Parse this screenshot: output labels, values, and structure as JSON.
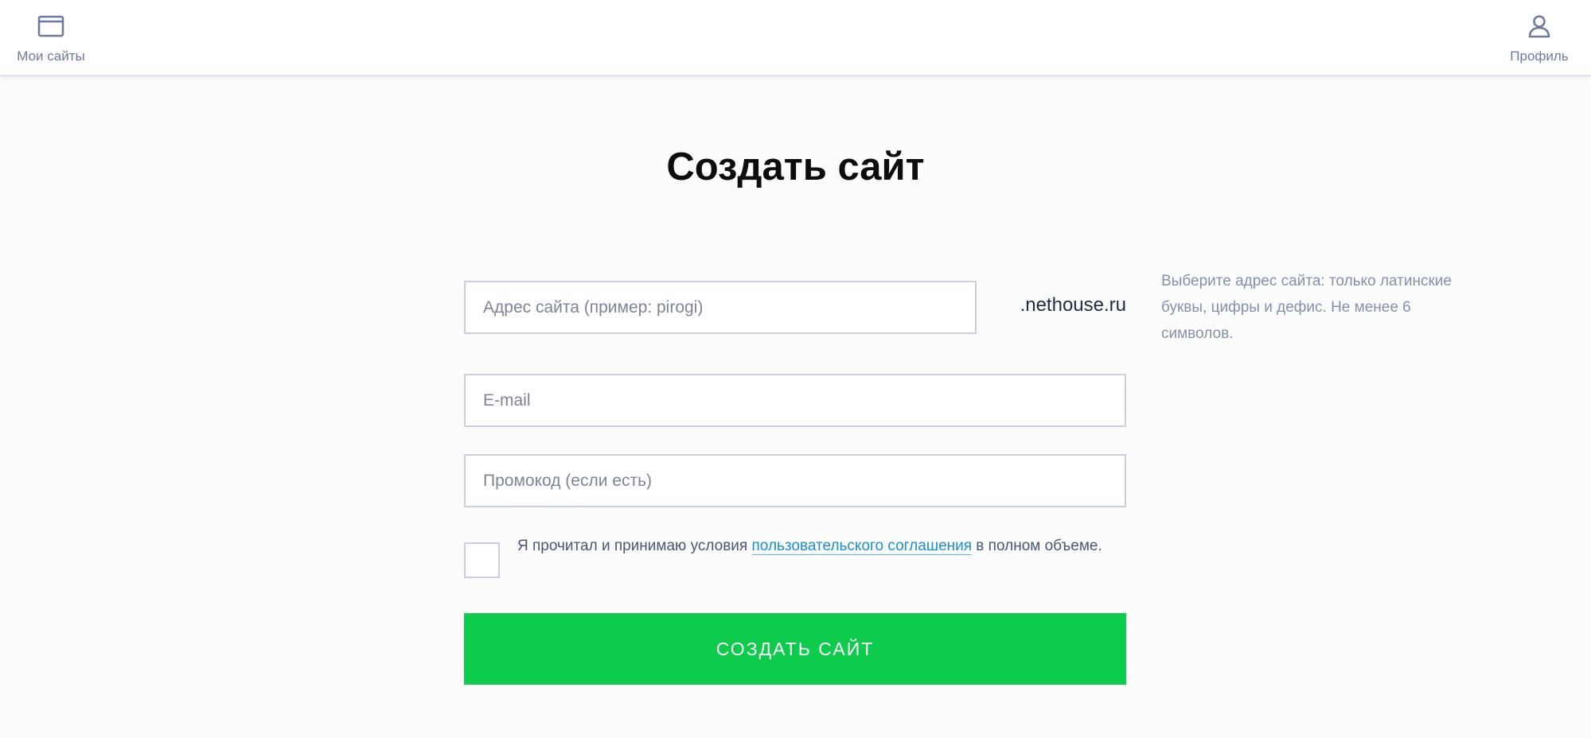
{
  "nav": {
    "my_sites": {
      "label": "Мои сайты",
      "icon": "browser-window-icon"
    },
    "profile": {
      "label": "Профиль",
      "icon": "user-icon"
    }
  },
  "page": {
    "title": "Создать сайт"
  },
  "form": {
    "address": {
      "placeholder": "Адрес сайта (пример: pirogi)",
      "value": ""
    },
    "domain_suffix": ".nethouse.ru",
    "address_hint": "Выберите адрес сайта: только латинские буквы, цифры и дефис. Не менее 6 символов.",
    "email": {
      "placeholder": "E-mail",
      "value": ""
    },
    "promo": {
      "placeholder": "Промокод (если есть)",
      "value": ""
    },
    "agreement": {
      "checked": false,
      "text_before": "Я прочитал и принимаю условия ",
      "link_text": "пользовательского соглашения",
      "text_after": " в полном объеме."
    },
    "submit_label": "СОЗДАТЬ САЙТ"
  },
  "colors": {
    "accent_green": "#0dcb4b",
    "link_blue": "#1a8fd1",
    "nav_icon": "#6b7a9c",
    "hint_text": "#8490ac",
    "border": "#c9cfe0"
  }
}
